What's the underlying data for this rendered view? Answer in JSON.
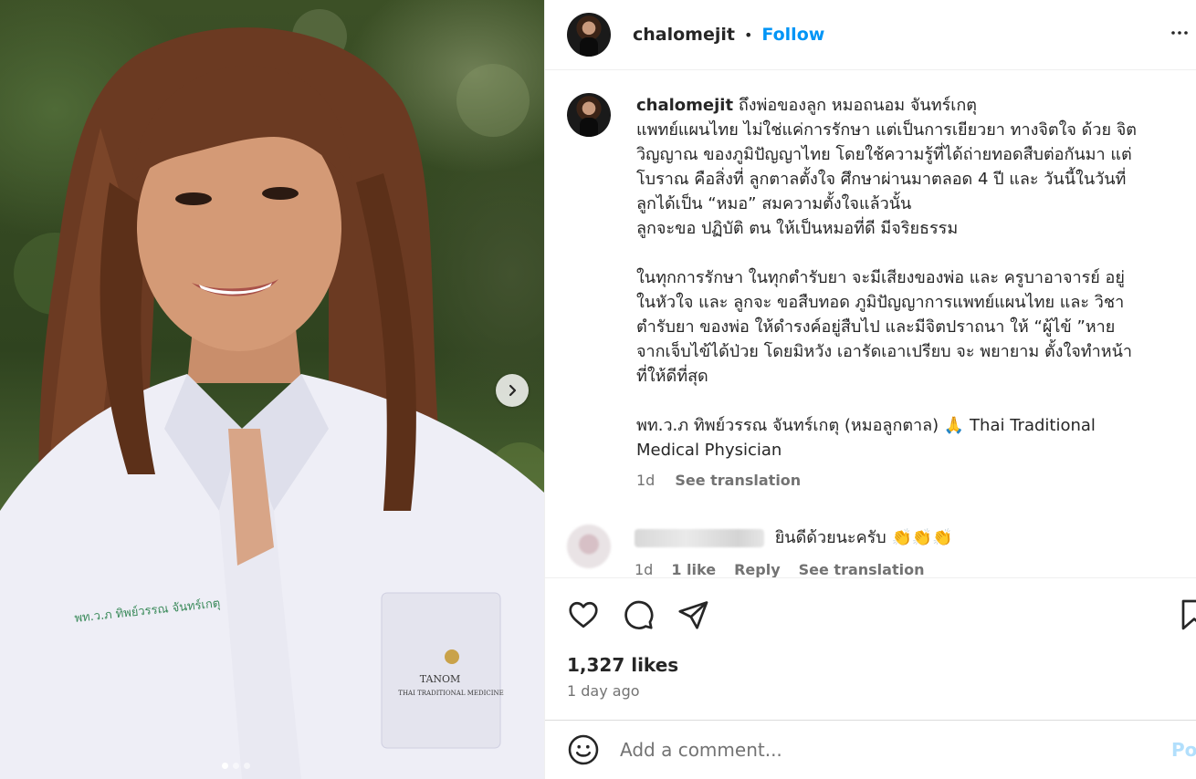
{
  "post": {
    "image_alt": "Portrait photo of a smiling woman in a white coat",
    "carousel": {
      "total": 3,
      "active": 0
    },
    "coat_embroidery": "พท.ว.ภ ทิพย์วรรณ จันทร์เกตุ",
    "coat_logo_line1": "TANOM",
    "coat_logo_line2": "THAI TRADITIONAL MEDICINE"
  },
  "header": {
    "username": "chalomejit",
    "separator": "•",
    "follow_label": "Follow"
  },
  "caption": {
    "username": "chalomejit",
    "first_line": "ถึงพ่อของลูก หมอถนอม จันทร์เกตุ",
    "lines": [
      "แพทย์แผนไทย ไม่ใช่แค่การรักษา แต่เป็นการเยียวยา ทางจิตใจ ด้วย จิต",
      "วิญญาณ ของภูมิปัญญาไทย โดยใช้ความรู้ที่ได้ถ่ายทอดสืบต่อกันมา แต่",
      "โบราณ คือสิ่งที่ ลูกตาลตั้งใจ ศึกษาผ่านมาตลอด 4 ปี และ วันนี้ในวันที่",
      "ลูกได้เป็น “หมอ” สมความตั้งใจแล้วนั้น",
      "ลูกจะขอ ปฏิบัติ ตน ให้เป็นหมอที่ดี มีจริยธรรม",
      "",
      "ในทุกการรักษา ในทุกตำรับยา จะมีเสียงของพ่อ และ ครูบาอาจารย์ อยู่",
      "ในหัวใจ และ ลูกจะ ขอสืบทอด ภูมิปัญญาการแพทย์แผนไทย และ วิชา",
      "ตำรับยา ของพ่อ ให้ดำรงค์อยู่สืบไป และมีจิตปราถนา ให้ “ผู้ไข้ ”หาย",
      "จากเจ็บไข้ได้ป่วย โดยมิหวัง เอารัดเอาเปรียบ จะ พยายาม ตั้งใจทำหน้า",
      "ที่ให้ดีที่สุด",
      "",
      "พท.ว.ภ ทิพย์วรรณ จันทร์เกตุ (หมอลูกตาล) 🙏 Thai Traditional",
      "Medical Physician"
    ],
    "time": "1d",
    "see_translation": "See translation"
  },
  "comment": {
    "text": "ยินดีด้วยนะครับ",
    "emojis": "👏👏👏",
    "time": "1d",
    "likes": "1 like",
    "reply": "Reply",
    "see_translation": "See translation"
  },
  "actions": {
    "likes_text": "1,327 likes",
    "time_ago": "1 day ago"
  },
  "comment_box": {
    "placeholder": "Add a comment...",
    "post_label": "Post"
  }
}
